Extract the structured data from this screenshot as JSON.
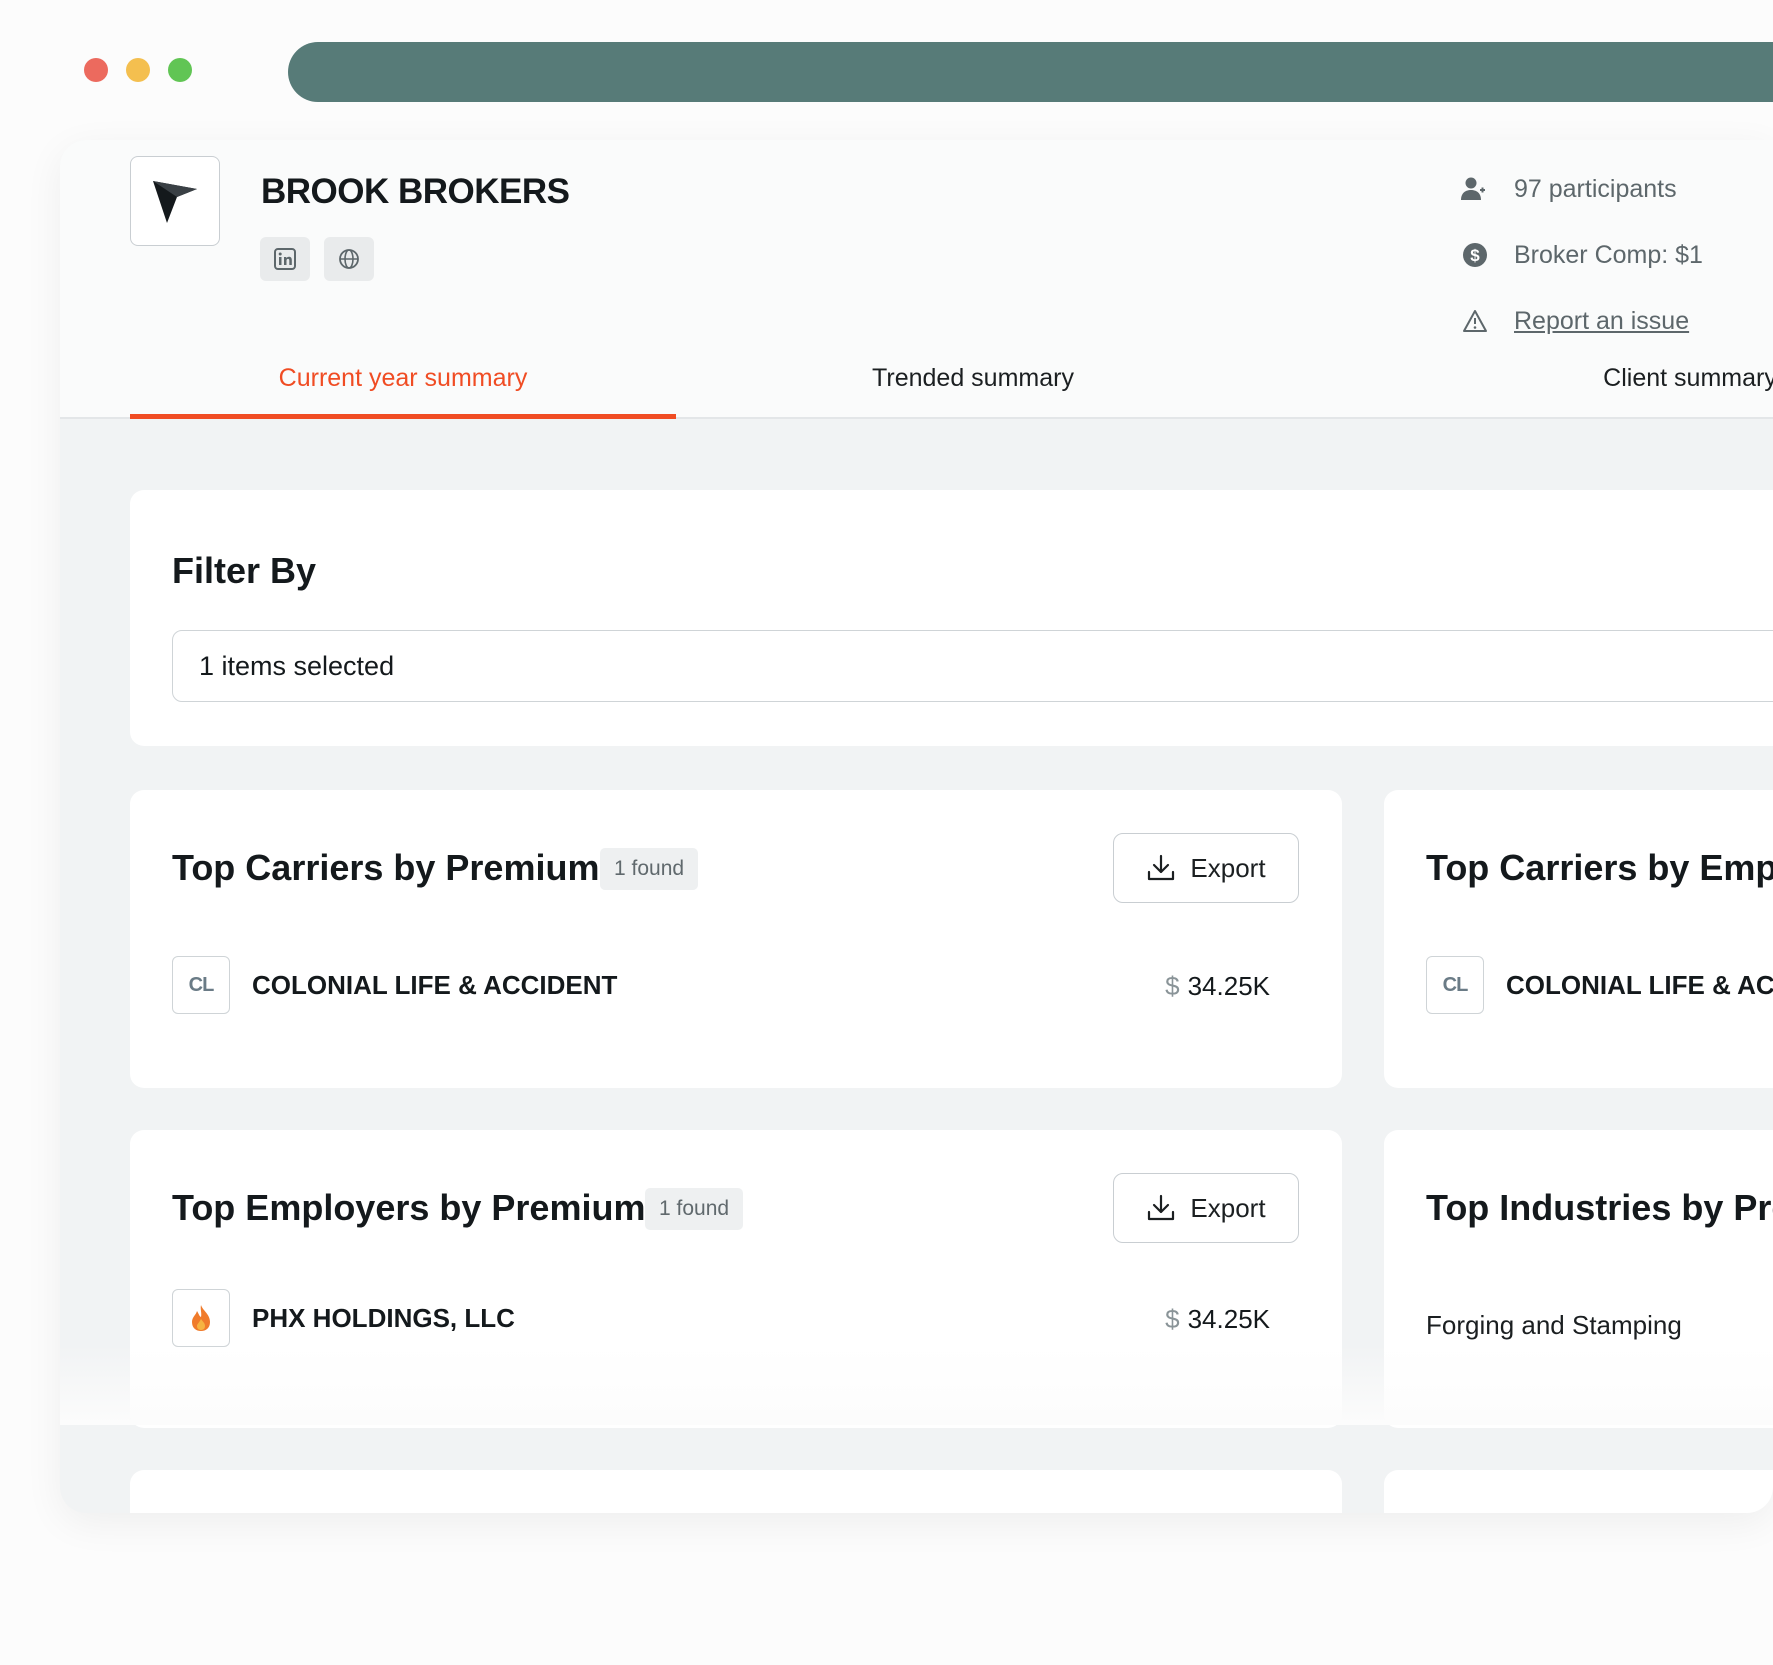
{
  "company": {
    "name": "BROOK BROKERS",
    "participants": "97 participants",
    "broker_comp": "Broker Comp: $1",
    "report_issue": "Report an issue"
  },
  "tabs": [
    {
      "label": "Current year summary",
      "active": true
    },
    {
      "label": "Trended summary",
      "active": false
    },
    {
      "label": "Client summary",
      "active": false
    }
  ],
  "filter": {
    "title": "Filter By",
    "value": "1 items selected"
  },
  "cards": {
    "carriers_premium": {
      "title": "Top Carriers by Premium",
      "badge": "1 found",
      "export_label": "Export",
      "rows": [
        {
          "logo_text": "CL",
          "name": "COLONIAL LIFE & ACCIDENT",
          "currency": "$",
          "amount": "34.25K"
        }
      ]
    },
    "carriers_employees": {
      "title": "Top Carriers by Emp",
      "rows": [
        {
          "logo_text": "CL",
          "name": "COLONIAL LIFE & ACC"
        }
      ]
    },
    "employers_premium": {
      "title": "Top Employers by Premium",
      "badge": "1 found",
      "export_label": "Export",
      "rows": [
        {
          "name": "PHX HOLDINGS, LLC",
          "currency": "$",
          "amount": "34.25K"
        }
      ]
    },
    "industries_premium": {
      "title": "Top Industries by Pre",
      "rows": [
        {
          "name": "Forging and Stamping"
        }
      ]
    }
  },
  "colors": {
    "accent": "#f04c23",
    "url_bar": "#577b78",
    "background": "#f1f3f4"
  }
}
